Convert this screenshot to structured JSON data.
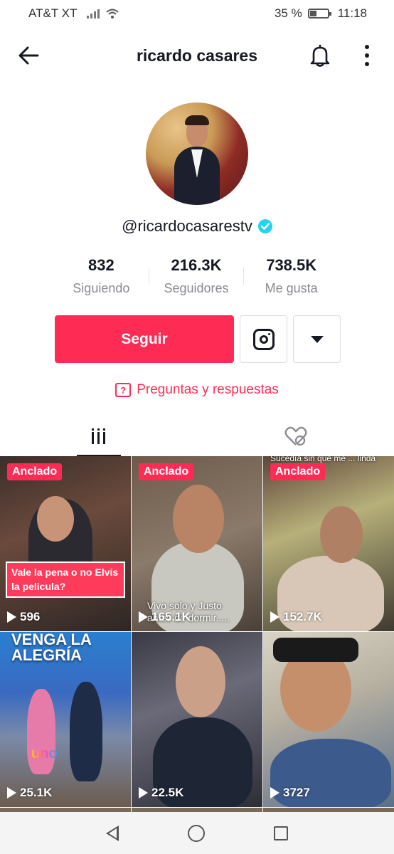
{
  "status_bar": {
    "carrier": "AT&T XT",
    "battery_pct_text": "35 %",
    "battery_level": 0.35,
    "time": "11:18"
  },
  "header": {
    "title": "ricardo casares",
    "icons": {
      "back": "arrow-left-icon",
      "notifications": "bell-icon",
      "more": "more-vertical-icon"
    }
  },
  "profile": {
    "username": "@ricardocasarestv",
    "verified": true,
    "accent": "#20d5ec"
  },
  "stats": {
    "following_value": "832",
    "following_label": "Siguiendo",
    "followers_value": "216.3K",
    "followers_label": "Seguidores",
    "likes_value": "738.5K",
    "likes_label": "Me gusta"
  },
  "actions": {
    "follow_label": "Seguir",
    "brand_color": "#fe2c55",
    "icons": {
      "instagram": "instagram-icon",
      "dropdown": "caret-down-icon"
    }
  },
  "qa": {
    "label": "Preguntas y respuestas",
    "icon_glyph": "?"
  },
  "tabs": [
    {
      "name": "videos",
      "icon": "grid-icon",
      "active": true
    },
    {
      "name": "liked",
      "icon": "liked-hidden-icon",
      "active": false
    }
  ],
  "videos": [
    {
      "pinned_label": "Anclado",
      "views": "596",
      "caption": "Vale la pena o no Elvis la pelicula?"
    },
    {
      "pinned_label": "Anclado",
      "views": "165.1K",
      "caption": "Vivo solo y Justo antes de dormir....."
    },
    {
      "pinned_label": "Anclado",
      "views": "152.7K",
      "caption": "Sucedía sin que me ... linda melodía"
    },
    {
      "pinned_label": "",
      "views": "25.1K",
      "caption": "VENGA LA ALEGRÍA",
      "logo": "uno"
    },
    {
      "pinned_label": "",
      "views": "22.5K",
      "caption": ""
    },
    {
      "pinned_label": "",
      "views": "3727",
      "caption": ""
    }
  ]
}
